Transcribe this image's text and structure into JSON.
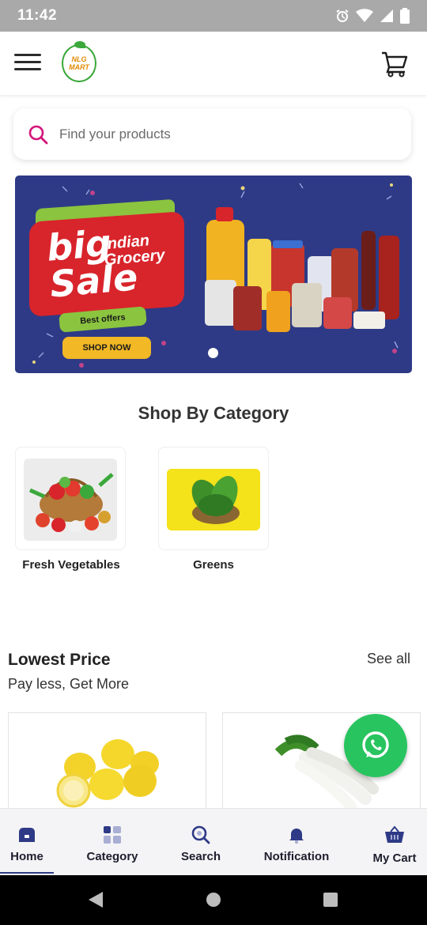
{
  "status_bar": {
    "time": "11:42",
    "icons": [
      "alarm-icon",
      "wifi-icon",
      "signal-icon",
      "battery-icon"
    ]
  },
  "header": {
    "logo_line1": "NLG",
    "logo_line2": "MART",
    "menu_icon": "hamburger-menu-icon",
    "cart_icon": "shopping-cart-icon"
  },
  "search": {
    "placeholder": "Find your products",
    "icon": "search-icon",
    "accent": "#d4147a"
  },
  "banner": {
    "headline_big1": "big",
    "headline_small1": "Indian",
    "headline_small2": "Grocery",
    "headline_big2": "Sale",
    "tag": "Best offers",
    "button_label": "SHOP NOW",
    "colors": {
      "background": "#2e3a86",
      "card": "#d8242b",
      "accent_green": "#8bc43f",
      "button": "#f2b826"
    }
  },
  "category_section": {
    "title": "Shop By Category",
    "items": [
      {
        "label": "Fresh Vegetables",
        "image": "vegetable-basket-image"
      },
      {
        "label": "Greens",
        "image": "spinach-greens-image"
      }
    ]
  },
  "lowest_price": {
    "title": "Lowest Price",
    "subtitle": "Pay less, Get More",
    "see_all": "See all",
    "products": [
      {
        "image": "lemons-image"
      },
      {
        "image": "radish-image"
      }
    ]
  },
  "whatsapp": {
    "icon": "whatsapp-icon",
    "color": "#28c45f"
  },
  "bottom_nav": {
    "items": [
      {
        "label": "Home",
        "icon": "home-icon",
        "active": true
      },
      {
        "label": "Category",
        "icon": "grid-icon",
        "active": false
      },
      {
        "label": "Search",
        "icon": "search-icon",
        "active": false
      },
      {
        "label": "Notification",
        "icon": "bell-icon",
        "active": false
      },
      {
        "label": "My Cart",
        "icon": "basket-icon",
        "active": false
      }
    ],
    "accent": "#2e3a86"
  },
  "system_nav": {
    "back": "back-triangle-icon",
    "home": "home-circle-icon",
    "recents": "recents-square-icon"
  }
}
